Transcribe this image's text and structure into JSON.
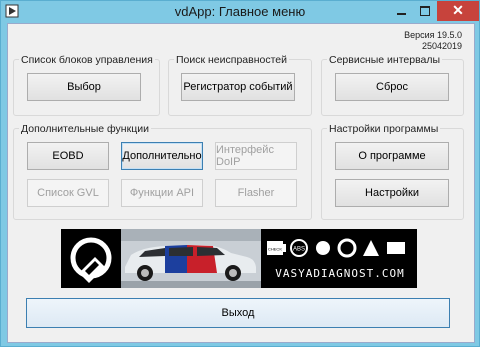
{
  "window": {
    "title": "vdApp:  Главное меню",
    "close_glyph": "✕"
  },
  "version": {
    "line1": "Версия 19.5.0",
    "line2": "25042019"
  },
  "groups": {
    "control_units": {
      "label": "Список блоков управления",
      "button": "Выбор"
    },
    "fault_search": {
      "label": "Поиск неисправностей",
      "button": "Регистратор событий"
    },
    "service": {
      "label": "Сервисные интервалы",
      "button": "Сброс"
    },
    "extra": {
      "label": "Дополнительные функции",
      "buttons": [
        "EOBD",
        "Дополнительно",
        "Интерфейс DoIP",
        "Список GVL",
        "Функции API",
        "Flasher"
      ]
    },
    "settings": {
      "label": "Настройки программы",
      "buttons": [
        "О программе",
        "Настройки"
      ]
    }
  },
  "banner": {
    "url": "VASYADIAGNOST.COM",
    "badge_abs": "ABS",
    "badge_check": "CHECK"
  },
  "exit_button": "Выход"
}
